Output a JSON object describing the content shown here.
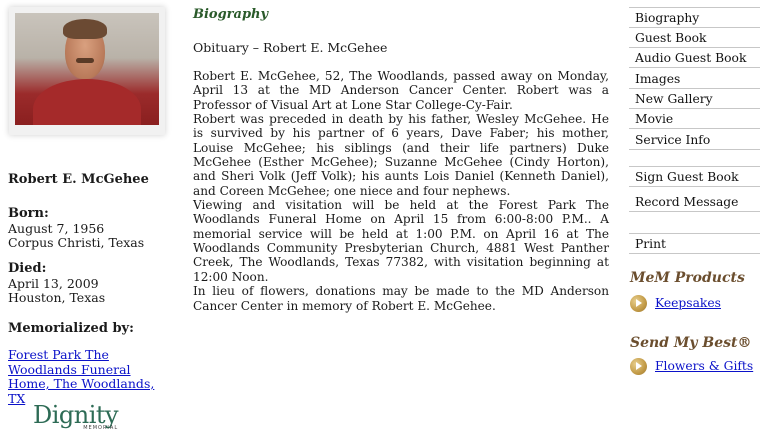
{
  "profile": {
    "name": "Robert E. McGehee",
    "born_label": "Born:",
    "born_date": "August 7, 1956",
    "born_place": "Corpus Christi, Texas",
    "died_label": "Died:",
    "died_date": "April 13, 2009",
    "died_place": "Houston, Texas",
    "memorialized_label": "Memorialized by:",
    "funeral_home_link": "Forest Park The Woodlands Funeral Home, The Woodlands, TX",
    "logo_text": "Dignity",
    "logo_subtext": "MEMORIAL"
  },
  "biography": {
    "section_title": "Biography",
    "obituary_title": "Obituary – Robert E. McGehee",
    "paragraphs": [
      "Robert E. McGehee, 52, The Woodlands, passed away on Monday, April 13 at the MD Anderson Cancer Center. Robert was a Professor of Visual Art at Lone Star College-Cy-Fair.",
      "Robert was preceded in death by his father, Wesley McGehee. He is survived by his partner of 6 years, Dave Faber; his mother, Louise McGehee; his siblings (and their life partners) Duke McGehee (Esther McGehee); Suzanne McGehee (Cindy Horton), and Sheri Volk (Jeff Volk); his aunts Lois Daniel (Kenneth Daniel), and Coreen McGehee; one niece and four nephews.",
      "Viewing and visitation will be held at the Forest Park The Woodlands Funeral Home on April 15 from 6:00-8:00 P.M.. A memorial service will be held at 1:00 P.M. on April 16 at The Woodlands Community Presbyterian Church, 4881 West Panther Creek, The Woodlands, Texas 77382, with visitation beginning at 12:00 Noon.",
      "In lieu of flowers, donations may be made to the MD Anderson Cancer Center in memory of Robert E. McGehee."
    ]
  },
  "menu": {
    "items": [
      "Biography",
      "Guest Book",
      "Audio Guest Book",
      "Images",
      "New Gallery",
      "Movie",
      "Service Info"
    ],
    "sign_guest_book": "Sign Guest Book",
    "record_message": "Record Message",
    "print": "Print"
  },
  "products": {
    "title": "MeM Products",
    "link": "Keepsakes"
  },
  "send_best": {
    "title": "Send My Best®",
    "link": "Flowers & Gifts"
  },
  "colors": {
    "link": "#0b12c9",
    "section_title": "#6b4e2e",
    "bio_title": "#2a5a2a",
    "logo": "#2d6b55"
  }
}
